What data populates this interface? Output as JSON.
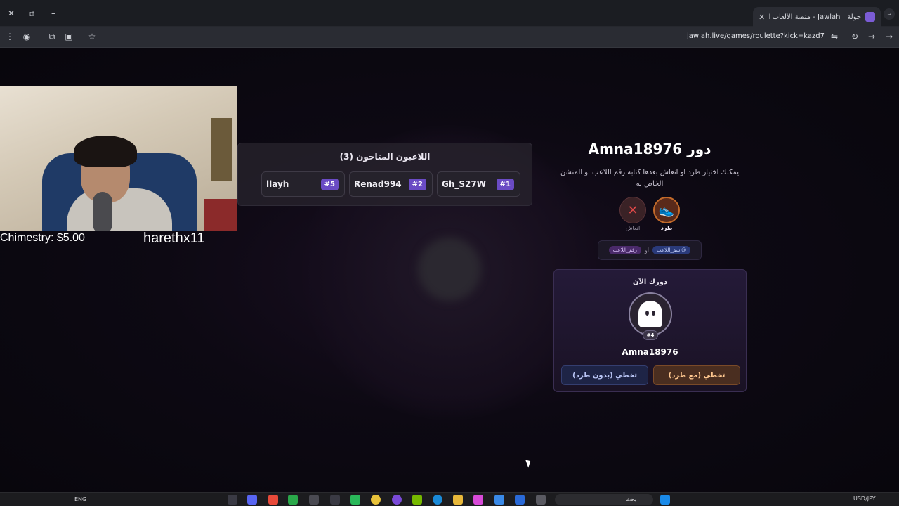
{
  "browser": {
    "tab_title": "جولة | Jawlah - منصة الألعاب الت",
    "tab_close": "✕",
    "new_tab": "+",
    "url": "jawlah.live/games/roulette?kick=kazd7",
    "window_close": "✕",
    "window_restore": "⧉",
    "window_minimize": "–"
  },
  "webcam": {
    "donation": "Chimestry: $5.00",
    "username": "harethx11"
  },
  "eliminated": {
    "title": "اللاعبون المتاحون (3)",
    "players": [
      {
        "name": "Gh_S27W",
        "num": "#1"
      },
      {
        "name": "Renad994",
        "num": "#2"
      },
      {
        "name": "llayh",
        "num": "#5"
      }
    ]
  },
  "turn": {
    "title": "دور Amna18976",
    "description": "يمكنك اختيار طرد او انعاش بعدها كتابة رقم اللاعب او المنشن الخاص به",
    "actions": {
      "kick_label": "طرد",
      "revive_label": "انعاش"
    },
    "hint": {
      "pill_name": "@اسم_اللاعب",
      "or": "أو",
      "pill_number": "رقم_اللاعب"
    },
    "now": {
      "title": "دورك الآن",
      "player_number": "#4",
      "player_name": "Amna18976",
      "skip_with_kick": "تخطي (مع طرد)",
      "skip_without_kick": "تخطي (بدون طرد)"
    }
  },
  "taskbar": {
    "lang": "ENG",
    "search": "بحث",
    "currency": "USD/JPY"
  },
  "colors": {
    "accent_purple": "#6a4bc4",
    "kick_orange": "#c26a2a",
    "revive_red": "#e04848"
  }
}
